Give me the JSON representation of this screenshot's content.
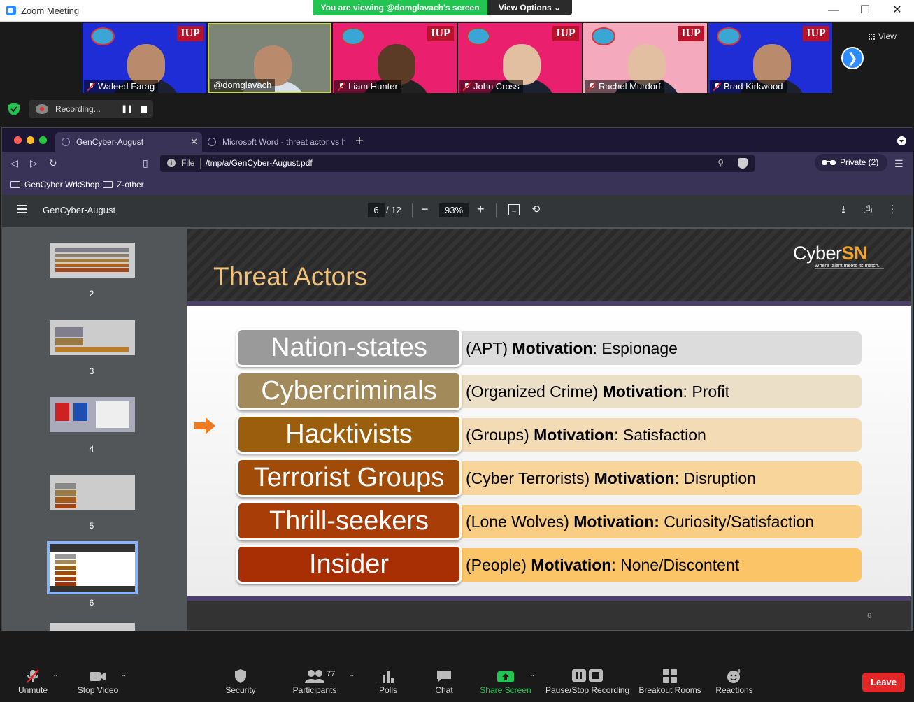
{
  "window": {
    "title": "Zoom Meeting"
  },
  "banner": {
    "viewing": "You are viewing @domglavach's screen",
    "view_options": "View Options ⌄"
  },
  "strip": {
    "view_label": "View",
    "participants": [
      {
        "name": "Waleed Farag",
        "muted": true,
        "bg": "blue"
      },
      {
        "name": "@domglavach",
        "muted": false,
        "bg": "room"
      },
      {
        "name": "Liam Hunter",
        "muted": true,
        "bg": "pink"
      },
      {
        "name": "John Cross",
        "muted": true,
        "bg": "pink"
      },
      {
        "name": "Rachel Murdorf",
        "muted": true,
        "bg": "lightpink"
      },
      {
        "name": "Brad Kirkwood",
        "muted": true,
        "bg": "blue"
      }
    ],
    "logo_text": "IUP",
    "recording_label": "Recording...",
    "pause_glyph": "❚❚"
  },
  "browser": {
    "tabs": [
      {
        "title": "GenCyber-August",
        "active": true
      },
      {
        "title": "Microsoft Word - threat actor vs hac",
        "active": false
      }
    ],
    "url_scheme": "File",
    "url_path": "/tmp/a/GenCyber-August.pdf",
    "private_label": "Private (2)",
    "bookmarks": [
      "GenCyber WrkShop",
      "Z-other"
    ]
  },
  "pdf": {
    "title": "GenCyber-August",
    "current_page": "6",
    "total_pages": "/ 12",
    "zoom": "93%",
    "thumbnails": [
      {
        "num": "2"
      },
      {
        "num": "3"
      },
      {
        "num": "4"
      },
      {
        "num": "5"
      },
      {
        "num": "6",
        "selected": true
      }
    ]
  },
  "slide": {
    "title": "Threat Actors",
    "brand_prefix": "Cyber",
    "brand_suffix": "SN",
    "tagline": "Where talent meets its match.",
    "page_number": "6",
    "rows": [
      {
        "label": "Nation-states",
        "prefix": "(APT) ",
        "bold": "Motivation",
        "rest": ": Espionage",
        "label_color": "#9b9a9a",
        "desc_color": "#dcdcdc"
      },
      {
        "label": "Cybercriminals",
        "prefix": "(Organized Crime) ",
        "bold": "Motivation",
        "rest": ": Profit",
        "label_color": "#a28a5a",
        "desc_color": "#ecdfc8"
      },
      {
        "label": "Hacktivists",
        "prefix": "(Groups) ",
        "bold": "Motivation",
        "rest": ": Satisfaction",
        "label_color": "#9a5e0c",
        "desc_color": "#f3dcb5"
      },
      {
        "label": "Terrorist Groups",
        "prefix": "(Cyber Terrorists) ",
        "bold": "Motivation",
        "rest": ": Disruption",
        "label_color": "#a04c08",
        "desc_color": "#f7d59b"
      },
      {
        "label": "Thrill-seekers",
        "prefix": "(Lone Wolves) ",
        "bold": "Motivation:",
        "rest": " Curiosity/Satisfaction",
        "label_color": "#a83d08",
        "desc_color": "#f9cd84"
      },
      {
        "label": "Insider",
        "prefix": "(People) ",
        "bold": "Motivation",
        "rest": ": None/Discontent",
        "label_color": "#a82e04",
        "desc_color": "#fbc466"
      }
    ]
  },
  "bottombar": {
    "unmute": "Unmute",
    "stop_video": "Stop Video",
    "security": "Security",
    "participants": "Participants",
    "participant_count": "77",
    "polls": "Polls",
    "chat": "Chat",
    "share_screen": "Share Screen",
    "pause_stop": "Pause/Stop Recording",
    "breakout": "Breakout Rooms",
    "reactions": "Reactions",
    "leave": "Leave"
  },
  "colors": {
    "zoom_blue": "#2d8cff",
    "zoom_green": "#23c552",
    "leave_red": "#e02828",
    "slide_title": "#f0c27a"
  }
}
